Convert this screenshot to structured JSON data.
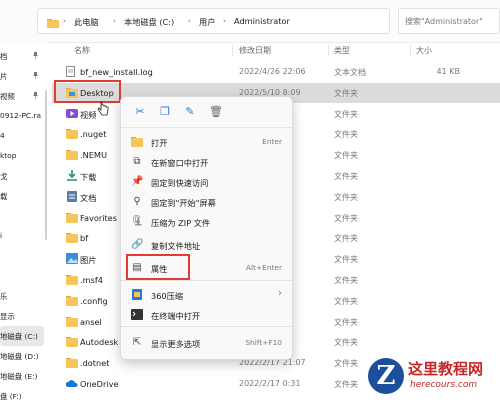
{
  "address": {
    "crumbs": [
      "此电脑",
      "本地磁盘 (C:)",
      "用户",
      "Administrator"
    ],
    "search_placeholder": "搜索\"Administrator\""
  },
  "nav": {
    "items": [
      "档",
      "片",
      "视频",
      "0912-PC.ra",
      "4",
      "ktop",
      "戈",
      "载",
      "",
      "i",
      "",
      "",
      "乐",
      "显示",
      "地磁盘 (C:)",
      "地磁盘 (D:)",
      "地磁盘 (E:)",
      "盘 (F:)"
    ],
    "pinned_rows": [
      0,
      1,
      2
    ],
    "selected_index": 14
  },
  "columns": {
    "name": "名称",
    "date": "修改日期",
    "type": "类型",
    "size": "大小"
  },
  "files": [
    {
      "name": "bf_new_install.log",
      "date": "2022/4/26 22:06",
      "type": "文本文档",
      "size": "41 KB",
      "icon": "doc"
    },
    {
      "name": "Desktop",
      "date": "2022/5/10 8:09",
      "type": "文件夹",
      "size": "",
      "icon": "folder-blue"
    },
    {
      "name": "视频",
      "date": "08",
      "type": "文件夹",
      "size": "",
      "icon": "video"
    },
    {
      "name": ".nuget",
      "date": "05",
      "type": "文件夹",
      "size": "",
      "icon": "folder"
    },
    {
      "name": ".NEMU",
      "date": "06",
      "type": "文件夹",
      "size": "",
      "icon": "folder"
    },
    {
      "name": "下载",
      "date": "59",
      "type": "文件夹",
      "size": "",
      "icon": "download"
    },
    {
      "name": "文档",
      "date": "57",
      "type": "文件夹",
      "size": "",
      "icon": "document-folder"
    },
    {
      "name": "Favorites",
      "date": "51",
      "type": "文件夹",
      "size": "",
      "icon": "folder"
    },
    {
      "name": "bf",
      "date": "36",
      "type": "文件夹",
      "size": "",
      "icon": "folder"
    },
    {
      "name": "图片",
      "date": "50",
      "type": "文件夹",
      "size": "",
      "icon": "picture"
    },
    {
      "name": ".msf4",
      "date": "",
      "type": "文件夹",
      "size": "",
      "icon": "folder"
    },
    {
      "name": ".config",
      "date": "",
      "type": "文件夹",
      "size": "",
      "icon": "folder"
    },
    {
      "name": "ansel",
      "date": "",
      "type": "文件夹",
      "size": "",
      "icon": "folder"
    },
    {
      "name": "Autodesk",
      "date": "",
      "type": "文件夹",
      "size": "",
      "icon": "folder"
    },
    {
      "name": ".dotnet",
      "date": "2022/2/17 21:07",
      "type": "文件夹",
      "size": "",
      "icon": "folder"
    },
    {
      "name": "OneDrive",
      "date": "2022/2/17 0:31",
      "type": "文件夹",
      "size": "",
      "icon": "onedrive"
    }
  ],
  "context_menu": {
    "quick_actions": [
      "cut-icon",
      "copy-icon",
      "rename-icon",
      "delete-icon"
    ],
    "items": [
      {
        "label": "打开",
        "shortcut": "Enter",
        "icon": "folder-open-icon"
      },
      {
        "label": "在新窗口中打开",
        "shortcut": "",
        "icon": "new-window-icon"
      },
      {
        "label": "固定到快速访问",
        "shortcut": "",
        "icon": "pin-icon"
      },
      {
        "label": "固定到\"开始\"屏幕",
        "shortcut": "",
        "icon": "pin-start-icon"
      },
      {
        "label": "压缩为 ZIP 文件",
        "shortcut": "",
        "icon": "zip-icon"
      },
      {
        "label": "复制文件地址",
        "shortcut": "",
        "icon": "copy-path-icon"
      },
      {
        "label": "属性",
        "shortcut": "Alt+Enter",
        "icon": "properties-icon"
      },
      {
        "label": "360压缩",
        "shortcut": "",
        "icon": "archive-360-icon",
        "submenu": true
      },
      {
        "label": "在终端中打开",
        "shortcut": "",
        "icon": "terminal-icon"
      },
      {
        "label": "显示更多选项",
        "shortcut": "Shift+F10",
        "icon": "more-options-icon"
      }
    ]
  },
  "watermark": {
    "title": "这里教程网",
    "url": "herecours.com"
  },
  "colors": {
    "accent": "#0067c0",
    "highlight_red": "#e53935",
    "folder": "#f7c55b"
  }
}
